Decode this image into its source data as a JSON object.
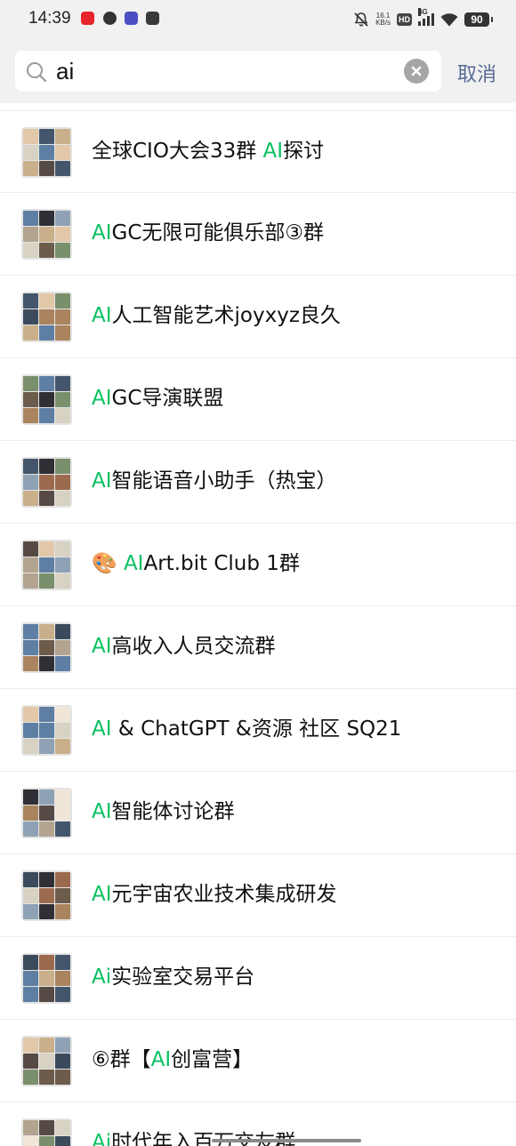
{
  "status_bar": {
    "time": "14:39",
    "net_speed": "16.1",
    "net_unit": "KB/s",
    "hd": "HD",
    "network": "4G",
    "battery": "90",
    "icons": [
      "app-notification-icon",
      "mute-icon",
      "signal-icon",
      "wifi-icon",
      "battery-icon"
    ]
  },
  "search": {
    "query": "ai",
    "cancel_label": "取消"
  },
  "colors": {
    "highlight": "#07c160",
    "cancel": "#576b95",
    "topbar": "#f1f1f1"
  },
  "results": [
    {
      "pre": "全球CIO大会33群 ",
      "hl": "AI",
      "post": "探讨"
    },
    {
      "pre": "",
      "hl": "AI",
      "post": "GC无限可能俱乐部③群"
    },
    {
      "pre": "",
      "hl": "AI",
      "post": "人工智能艺术joyxyz良久"
    },
    {
      "pre": "",
      "hl": "AI",
      "post": "GC导演联盟"
    },
    {
      "pre": "",
      "hl": "AI",
      "post": "智能语音小助手（热宝）"
    },
    {
      "pre": "🎨 ",
      "hl": "AI",
      "post": "Art.bit Club 1群"
    },
    {
      "pre": "",
      "hl": "AI",
      "post": "高收入人员交流群"
    },
    {
      "pre": "",
      "hl": "AI",
      "post": " & ChatGPT &资源 社区 SQ21"
    },
    {
      "pre": "",
      "hl": "AI",
      "post": "智能体讨论群"
    },
    {
      "pre": "",
      "hl": "AI",
      "post": "元宇宙农业技术集成研发"
    },
    {
      "pre": "",
      "hl": "Ai",
      "post": "实验室交易平台"
    },
    {
      "pre": "⑥群【",
      "hl": "AI",
      "post": "创富营】"
    },
    {
      "pre": "",
      "hl": "Ai",
      "post": "时代年入百万交友群"
    }
  ]
}
